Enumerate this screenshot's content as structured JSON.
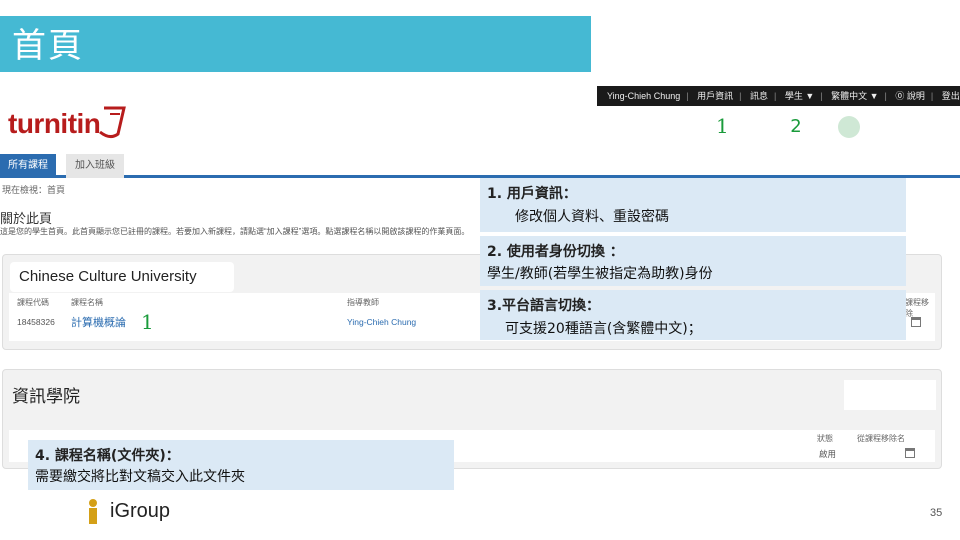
{
  "slide": {
    "title": "首頁",
    "page_number": "35",
    "footer_logo": "iGroup"
  },
  "topnav": {
    "items": [
      "Ying-Chieh Chung",
      "用戶資訊",
      "訊息",
      "學生 ▼",
      "繁體中文 ▼",
      "⓪ 說明",
      "登出"
    ]
  },
  "app": {
    "logo": "turnitin",
    "markers": [
      "1",
      "2"
    ],
    "tabs": [
      "所有課程",
      "加入班級"
    ],
    "breadcrumb": "現在檢視：首頁",
    "about_title": "關於此頁",
    "about_desc": "這是您的學生首頁。此首頁顯示您已註冊的課程。若要加入新課程，請點選“加入課程”選項。點選課程名稱以開啟該課程的作業頁面。"
  },
  "panel1": {
    "university": "Chinese Culture University",
    "headers": [
      "課程代碼",
      "課程名稱",
      "指導教師",
      "課程移除"
    ],
    "row": {
      "code": "18458326",
      "name": "計算機概論",
      "teacher": "Ying-Chieh Chung",
      "marker": "1"
    }
  },
  "panel2": {
    "college": "資訊學院",
    "headers": [
      "狀態",
      "從課程移除名"
    ],
    "row": {
      "status": "啟用"
    }
  },
  "callouts": [
    {
      "title": "1.  用戶資訊：",
      "body": "修改個人資料、重設密碼"
    },
    {
      "title": "2. 使用者身份切換 ：",
      "body": "學生/教師(若學生被指定為助教)身份"
    },
    {
      "title": "3.平台語言切換：",
      "body": "可支援20種語言(含繁體中文)；"
    },
    {
      "title": "4. 課程名稱(文件夾)：",
      "body": "需要繳交將比對文稿交入此文件夾"
    }
  ],
  "colors": {
    "banner": "#45b9d3",
    "callout_bg": "#dbe9f5",
    "turnitin_red": "#b71c1c",
    "marker_green": "#1a9b3b",
    "tab_blue": "#2b6cb0"
  }
}
